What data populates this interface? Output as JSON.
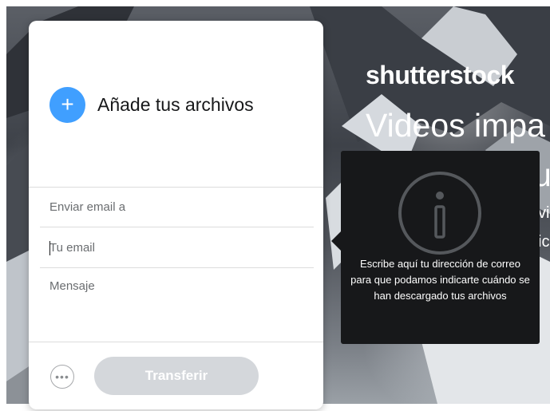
{
  "brand": {
    "name": "shutterstock"
  },
  "hero": {
    "headline": "Videos impa",
    "headline_line2": "u",
    "sub_line1": "vi",
    "sub_line2": "ic"
  },
  "panel": {
    "add_files_label": "Añade tus archivos",
    "send_to_placeholder": "Enviar email a",
    "your_email_placeholder": "Tu email",
    "message_placeholder": "Mensaje",
    "transfer_label": "Transferir",
    "more_options_glyph": "•••"
  },
  "tooltip": {
    "text": "Escribe aquí tu dirección de correo para que podamos indicarte cuándo se han descargado tus archivos"
  },
  "colors": {
    "accent": "#409fff",
    "tooltip_bg": "#17181a",
    "button_disabled": "#d4d7db"
  }
}
